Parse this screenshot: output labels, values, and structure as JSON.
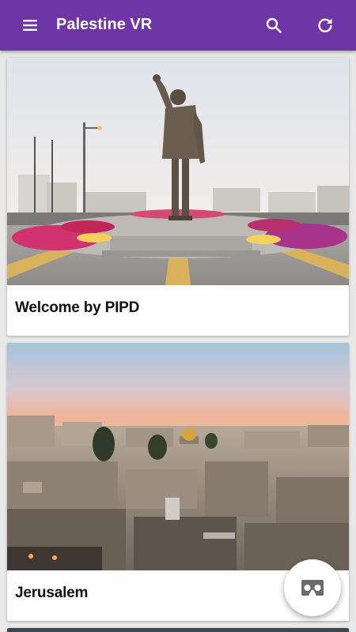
{
  "app_bar": {
    "title": "Palestine VR",
    "menu_icon": "menu-icon",
    "search_icon": "search-icon",
    "refresh_icon": "refresh-icon",
    "color": "#6e34a8"
  },
  "cards": [
    {
      "title": "Welcome by PIPD",
      "image": "statue-roundabout-photo"
    },
    {
      "title": "Jerusalem",
      "image": "jerusalem-skyline-photo"
    }
  ],
  "fab": {
    "icon": "vr-headset-icon"
  }
}
